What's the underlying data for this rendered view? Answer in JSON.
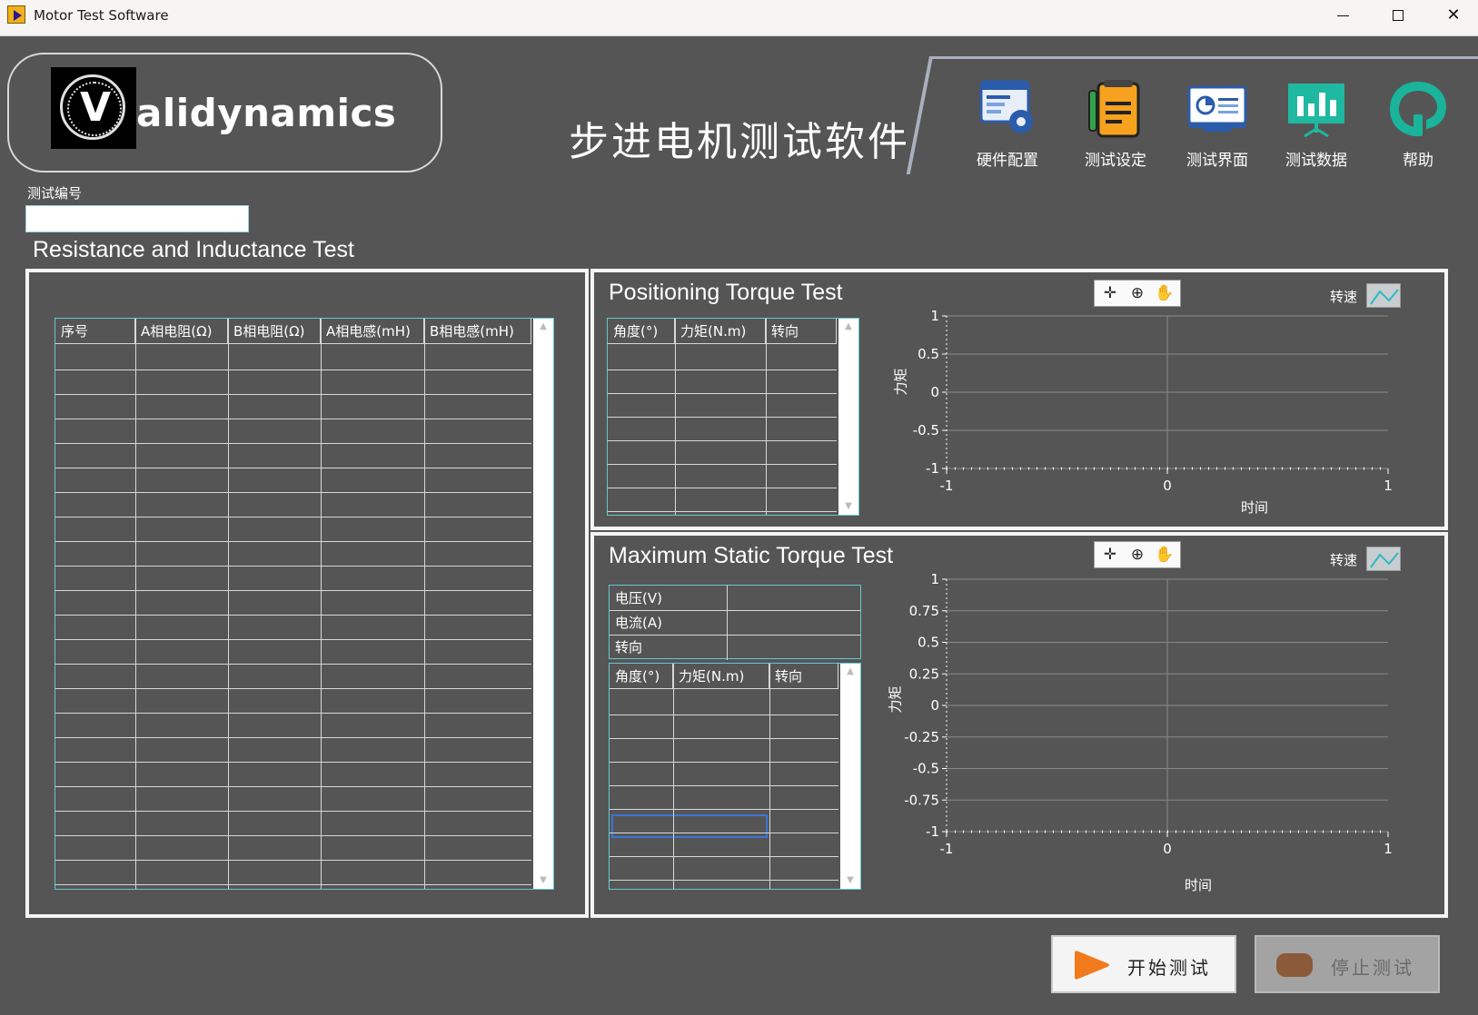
{
  "window": {
    "title": "Motor Test Software",
    "controls": {
      "minimize": "minimize-icon",
      "maximize": "maximize-icon",
      "close": "close-icon"
    }
  },
  "header": {
    "logo_text": "alidynamics",
    "logo_letter": "V",
    "app_title": "步进电机测试软件",
    "toolbar": [
      {
        "label": "硬件配置",
        "icon": "hardware-config-icon"
      },
      {
        "label": "测试设定",
        "icon": "test-settings-icon"
      },
      {
        "label": "测试界面",
        "icon": "test-interface-icon"
      },
      {
        "label": "测试数据",
        "icon": "test-data-icon"
      },
      {
        "label": "帮助",
        "icon": "help-icon"
      }
    ]
  },
  "test_number": {
    "label": "测试编号",
    "value": ""
  },
  "resistance": {
    "title": "Resistance and Inductance Test",
    "columns": [
      "序号",
      "A相电阻(Ω)",
      "B相电阻(Ω)",
      "A相电感(mH)",
      "B相电感(mH)"
    ]
  },
  "positioning": {
    "title": "Positioning Torque Test",
    "columns": [
      "角度(°)",
      "力矩(N.m)",
      "转向"
    ],
    "legend": "转速",
    "graph": {
      "ylabel": "力矩",
      "xlabel": "时间",
      "y_ticks": [
        "1",
        "0.5",
        "0",
        "-0.5",
        "-1"
      ],
      "x_ticks": [
        "-1",
        "0",
        "1"
      ]
    }
  },
  "static": {
    "title": "Maximum Static Torque Test",
    "params": [
      "电压(V)",
      "电流(A)",
      "转向"
    ],
    "columns": [
      "角度(°)",
      "力矩(N.m)",
      "转向"
    ],
    "legend": "转速",
    "graph": {
      "ylabel": "力矩",
      "xlabel": "时间",
      "y_ticks": [
        "1",
        "0.75",
        "0.5",
        "0.25",
        "0",
        "-0.25",
        "-0.5",
        "-0.75",
        "-1"
      ],
      "x_ticks": [
        "-1",
        "0",
        "1"
      ]
    }
  },
  "buttons": {
    "start": "开始测试",
    "stop": "停止测试"
  },
  "colors": {
    "background": "#555555",
    "panel_border": "#f4f4f4",
    "table_border": "#66c8d0",
    "start_icon": "#f07a1c",
    "stop_icon": "#8a5a3a"
  }
}
